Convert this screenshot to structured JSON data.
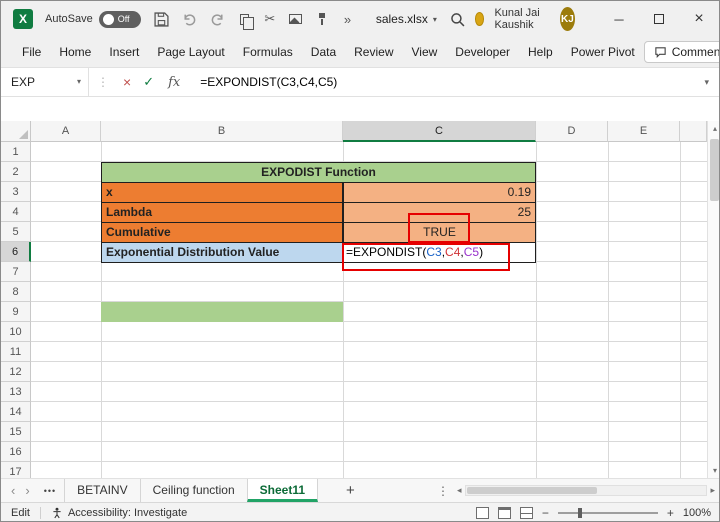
{
  "titlebar": {
    "app": "Excel",
    "autosave_label": "AutoSave",
    "autosave_state": "Off",
    "filename": "sales.xlsx",
    "user_name": "Kunal Jai Kaushik",
    "user_initials": "KJ"
  },
  "menubar": {
    "tabs": [
      "File",
      "Home",
      "Insert",
      "Page Layout",
      "Formulas",
      "Data",
      "Review",
      "View",
      "Developer",
      "Help",
      "Power Pivot"
    ],
    "comments_label": "Comments"
  },
  "formula_bar": {
    "name_box_value": "EXP",
    "fx_label": "fx",
    "formula_text": "=EXPONDIST(C3,C4,C5)",
    "formula_parts": [
      {
        "text": "=EXPONDIST(",
        "color": "#000000"
      },
      {
        "text": "C3",
        "color": "#1B63C8"
      },
      {
        "text": ",",
        "color": "#000000"
      },
      {
        "text": "C4",
        "color": "#D13438"
      },
      {
        "text": ",",
        "color": "#000000"
      },
      {
        "text": "C5",
        "color": "#9933CC"
      },
      {
        "text": ")",
        "color": "#000000"
      }
    ]
  },
  "grid": {
    "column_headers": [
      "A",
      "B",
      "C",
      "D",
      "E"
    ],
    "row_headers": [
      "1",
      "2",
      "3",
      "4",
      "5",
      "6",
      "7",
      "8",
      "9",
      "10",
      "11",
      "12",
      "13",
      "14",
      "15",
      "16",
      "17"
    ],
    "selected_column": "C",
    "selected_row": "6",
    "cells": [
      {
        "id": "B2",
        "text": "EXPODIST Function",
        "bg": "#A9D08E",
        "bold": true,
        "align": "center",
        "merge": "B-C",
        "bordered": true
      },
      {
        "id": "B3",
        "text": "x",
        "bg": "#ED7D31",
        "bold": true,
        "align": "left",
        "bordered": true
      },
      {
        "id": "C3",
        "text": "0.19",
        "bg": "#F4B183",
        "bold": false,
        "align": "right",
        "bordered": true
      },
      {
        "id": "B4",
        "text": "Lambda",
        "bg": "#ED7D31",
        "bold": true,
        "align": "left",
        "bordered": true
      },
      {
        "id": "C4",
        "text": "25",
        "bg": "#F4B183",
        "bold": false,
        "align": "right",
        "bordered": true
      },
      {
        "id": "B5",
        "text": "Cumulative",
        "bg": "#ED7D31",
        "bold": true,
        "align": "left",
        "bordered": true
      },
      {
        "id": "C5",
        "text": "TRUE",
        "bg": "#F4B183",
        "bold": false,
        "align": "center",
        "bordered": true
      },
      {
        "id": "B6",
        "text": "Exponential Distribution Value",
        "bg": "#BDD7EE",
        "bold": true,
        "align": "left",
        "bordered": true
      },
      {
        "id": "C6",
        "use_formula_parts": true,
        "bg": "#FFFFFF",
        "bold": false,
        "align": "left",
        "bordered": true
      },
      {
        "id": "B9",
        "text": "",
        "bg": "#A9D08E",
        "bold": false,
        "align": "left",
        "bordered": false
      }
    ]
  },
  "sheet_bar": {
    "tabs": [
      {
        "label": "BETAINV",
        "active": false
      },
      {
        "label": "Ceiling function",
        "active": false
      },
      {
        "label": "Sheet11",
        "active": true
      }
    ]
  },
  "status_bar": {
    "mode": "Edit",
    "accessibility": "Accessibility: Investigate",
    "zoom_percent": "100%"
  },
  "colors": {
    "excel_green": "#107C41",
    "header_fill_green": "#A9D08E",
    "label_fill_orange": "#ED7D31",
    "value_fill_orange": "#F4B183",
    "result_fill_blue": "#BDD7EE",
    "annotation_red": "#E60000",
    "avatar_gold": "#9C7C0C"
  }
}
